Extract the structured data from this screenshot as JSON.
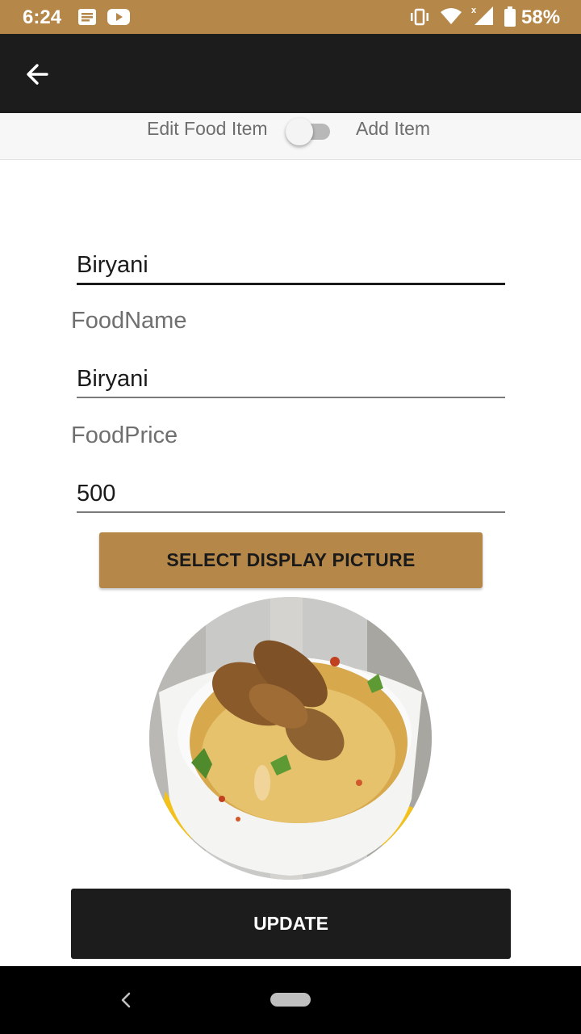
{
  "status_bar": {
    "time": "6:24",
    "left_icons": [
      "notification-text-icon",
      "youtube-icon"
    ],
    "right_icons": [
      "vibrate-icon",
      "wifi-icon",
      "cell-signal-icon",
      "battery-icon"
    ],
    "battery_percent": "58%",
    "background_color": "#b5884a"
  },
  "app_bar": {
    "back_icon": "arrow-left-icon",
    "background_color": "#1c1c1c"
  },
  "mode_toggle": {
    "left_label": "Edit Food Item",
    "right_label": "Add Item",
    "checked": false
  },
  "form": {
    "category_value": "Biryani",
    "food_name_label": "FoodName",
    "food_name_value": "Biryani",
    "food_price_label": "FoodPrice",
    "food_price_value": "500"
  },
  "buttons": {
    "select_picture": "SELECT DISPLAY PICTURE",
    "update": "UPDATE"
  },
  "image": {
    "subject": "biryani-dish-photo"
  },
  "nav_bar": {
    "back_icon": "nav-back-icon",
    "home_icon": "home-pill-icon"
  },
  "colors": {
    "accent": "#b5884a",
    "dark": "#1c1c1c"
  }
}
